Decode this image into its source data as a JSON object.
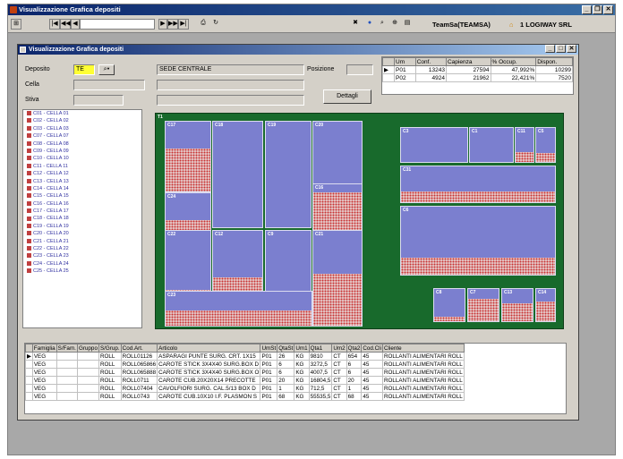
{
  "app": {
    "title": "Visualizzazione Grafica depositi",
    "brand_color": "#0a246a"
  },
  "toolbar": {
    "nav_first": "|◀",
    "nav_prev2": "◀◀",
    "nav_prev": "◀",
    "nav_next": "▶",
    "nav_next2": "▶▶",
    "nav_last": "▶|",
    "user": "TeamSa(TEAMSA)",
    "company": "1 LOGIWAY SRL"
  },
  "form": {
    "window_title": "Visualizzazione Grafica depositi",
    "deposito_label": "Deposito",
    "deposito_value": "TE",
    "deposito_desc": "SEDE CENTRALE",
    "cella_label": "Cella",
    "stiva_label": "Stiva",
    "posizione_label": "Posizione",
    "dettagli_label": "Dettagli"
  },
  "summary_grid": {
    "columns": [
      "Um",
      "Conf.",
      "Capienza",
      "% Occup.",
      "Dispon."
    ],
    "rows": [
      {
        "um": "P01",
        "conf": "13243",
        "capienza": "27594",
        "occup": "47,992%",
        "dispon": "10299"
      },
      {
        "um": "P02",
        "conf": "4924",
        "capienza": "21962",
        "occup": "22,421%",
        "dispon": "7520"
      }
    ]
  },
  "cell_list": [
    "C01 - CELLA 01",
    "C02 - CELLA 02",
    "C03 - CELLA 03",
    "C07 - CELLA 07",
    "C08 - CELLA 08",
    "C09 - CELLA 09",
    "C10 - CELLA 10",
    "C11 - CELLA 11",
    "C12 - CELLA 12",
    "C13 - CELLA 13",
    "C14 - CELLA 14",
    "C15 - CELLA 15",
    "C16 - CELLA 16",
    "C17 - CELLA 17",
    "C18 - CELLA 18",
    "C19 - CELLA 19",
    "C20 - CELLA 20",
    "C21 - CELLA 21",
    "C22 - CELLA 22",
    "C23 - CELLA 23",
    "C24 - CELLA 24",
    "C25 - CELLA 25"
  ],
  "map": {
    "label": "T1",
    "cells": [
      {
        "id": "C17",
        "fill": 0.62
      },
      {
        "id": "C18",
        "fill": 0.0
      },
      {
        "id": "C19",
        "fill": 0.0
      },
      {
        "id": "C20",
        "fill": 0.0
      },
      {
        "id": "C24",
        "fill": 0.35
      },
      {
        "id": "C16",
        "fill": 0.85
      },
      {
        "id": "C22",
        "fill": 0.05
      },
      {
        "id": "C12",
        "fill": 0.25
      },
      {
        "id": "C9",
        "fill": 0.0
      },
      {
        "id": "C21",
        "fill": 0.55
      },
      {
        "id": "C23",
        "fill": 0.45
      },
      {
        "id": "C3",
        "fill": 0.0
      },
      {
        "id": "C1",
        "fill": 0.0
      },
      {
        "id": "C11",
        "fill": 0.28
      },
      {
        "id": "C5",
        "fill": 0.25
      },
      {
        "id": "C31",
        "fill": 0.3
      },
      {
        "id": "C6",
        "fill": 0.25
      },
      {
        "id": "C8",
        "fill": 0.15
      },
      {
        "id": "C7",
        "fill": 0.7
      },
      {
        "id": "C13",
        "fill": 0.55
      },
      {
        "id": "C14",
        "fill": 0.6
      },
      {
        "id": "C15",
        "fill": 0.6
      },
      {
        "id": "C2",
        "fill": 0.25
      }
    ]
  },
  "detail_grid": {
    "columns": [
      "Famiglia",
      "S/Fam.",
      "Gruppo",
      "S/Grup.",
      "Cod.Art.",
      "Articolo",
      "UmSt",
      "QtaSt",
      "Um1",
      "Qta1",
      "Um2",
      "Qta2",
      "Cod.Cli",
      "Cliente"
    ],
    "rows": [
      [
        "VEG",
        "",
        "",
        "ROLL",
        "ROLL01126",
        "ASPARAGI PUNTE SURG. CRT. 1X15",
        "P01",
        "26",
        "KG",
        "9810",
        "CT",
        "654",
        "45",
        "ROLLANTI ALIMENTARI ROLL"
      ],
      [
        "VEG",
        "",
        "",
        "ROLL",
        "ROLL065866",
        "CAROTE STICK 3X4X40 SURG.BOX D",
        "P01",
        "6",
        "KG",
        "3272,5",
        "CT",
        "6",
        "45",
        "ROLLANTI ALIMENTARI ROLL"
      ],
      [
        "VEG",
        "",
        "",
        "ROLL",
        "ROLL065888",
        "CAROTE STICK 3X4X40 SURG.BOX O",
        "P01",
        "6",
        "KG",
        "4007,5",
        "CT",
        "6",
        "45",
        "ROLLANTI ALIMENTARI ROLL"
      ],
      [
        "VEG",
        "",
        "",
        "ROLL",
        "ROLL0711",
        "CAROTE CUB.20X20X14 PRECOTTE",
        "P01",
        "20",
        "KG",
        "16804,5",
        "CT",
        "20",
        "45",
        "ROLLANTI ALIMENTARI ROLL"
      ],
      [
        "VEG",
        "",
        "",
        "ROLL",
        "ROLL07404",
        "CAVOLFIORI SURG. CAL.5/13 BOX D",
        "P01",
        "1",
        "KG",
        "712,5",
        "CT",
        "1",
        "45",
        "ROLLANTI ALIMENTARI ROLL"
      ],
      [
        "VEG",
        "",
        "",
        "ROLL",
        "ROLL0743",
        "CAROTE CUB.10X10 I.F. PLASMON S",
        "P01",
        "68",
        "KG",
        "55535,5",
        "CT",
        "68",
        "45",
        "ROLLANTI ALIMENTARI ROLL"
      ]
    ]
  }
}
